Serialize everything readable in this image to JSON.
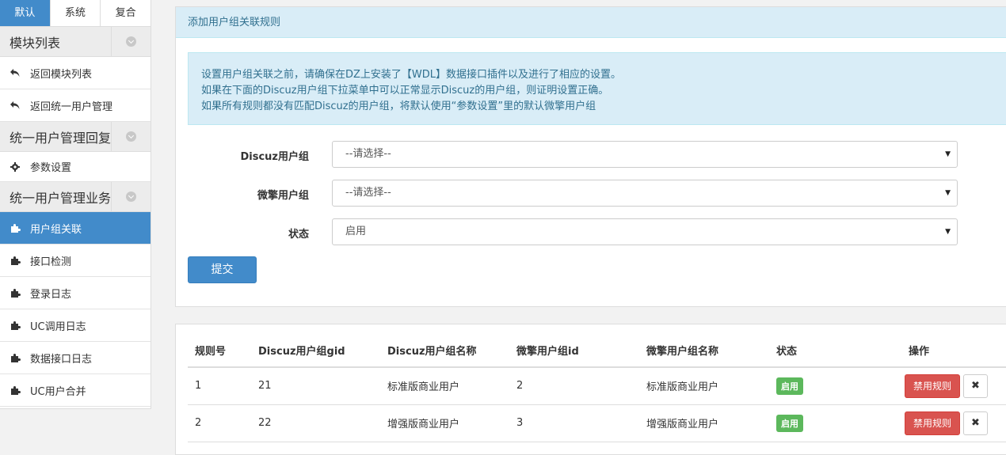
{
  "sidebar": {
    "tabs": [
      {
        "label": "默认",
        "active": true
      },
      {
        "label": "系统",
        "active": false
      },
      {
        "label": "复合",
        "active": false
      }
    ],
    "sections": [
      {
        "title": "模块列表",
        "items": [
          {
            "label": "返回模块列表",
            "icon": "reply-icon"
          },
          {
            "label": "返回统一用户管理",
            "icon": "reply-icon"
          }
        ]
      },
      {
        "title": "统一用户管理回复",
        "items": [
          {
            "label": "参数设置",
            "icon": "gear-icon"
          }
        ]
      },
      {
        "title": "统一用户管理业务",
        "items": [
          {
            "label": "用户组关联",
            "icon": "puzzle-icon",
            "active": true
          },
          {
            "label": "接口检测",
            "icon": "puzzle-icon"
          },
          {
            "label": "登录日志",
            "icon": "puzzle-icon"
          },
          {
            "label": "UC调用日志",
            "icon": "puzzle-icon"
          },
          {
            "label": "数据接口日志",
            "icon": "puzzle-icon"
          },
          {
            "label": "UC用户合并",
            "icon": "puzzle-icon"
          }
        ]
      }
    ]
  },
  "form_panel": {
    "heading": "添加用户组关联规则",
    "info_lines": [
      "设置用户组关联之前，请确保在DZ上安装了【WDL】数据接口插件以及进行了相应的设置。",
      "如果在下面的Discuz用户组下拉菜单中可以正常显示Discuz的用户组，则证明设置正确。",
      "如果所有规则都没有匹配Discuz的用户组，将默认使用“参数设置”里的默认微擎用户组"
    ],
    "fields": [
      {
        "label": "Discuz用户组",
        "value": "--请选择--"
      },
      {
        "label": "微擎用户组",
        "value": "--请选择--"
      },
      {
        "label": "状态",
        "value": "启用"
      }
    ],
    "submit_label": "提交"
  },
  "rules_table": {
    "headers": [
      "规则号",
      "Discuz用户组gid",
      "Discuz用户组名称",
      "微擎用户组id",
      "微擎用户组名称",
      "状态",
      "操作"
    ],
    "rows": [
      {
        "id": "1",
        "gid": "21",
        "discuz_name": "标准版商业用户",
        "we_id": "2",
        "we_name": "标准版商业用户",
        "status": "启用",
        "disable_label": "禁用规则",
        "delete_label": "✖"
      },
      {
        "id": "2",
        "gid": "22",
        "discuz_name": "增强版商业用户",
        "we_id": "3",
        "we_name": "增强版商业用户",
        "status": "启用",
        "disable_label": "禁用规则",
        "delete_label": "✖"
      }
    ]
  }
}
